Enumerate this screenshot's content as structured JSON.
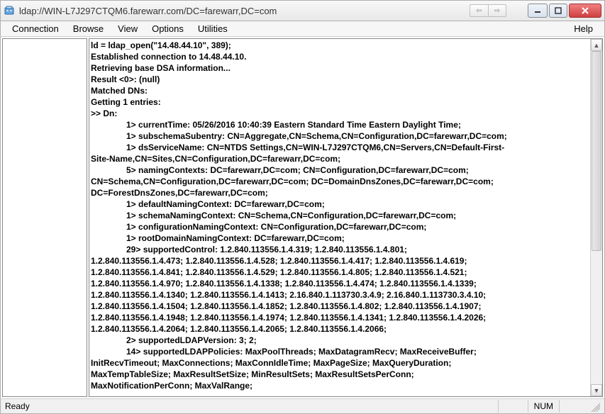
{
  "window": {
    "title": "ldap://WIN-L7J297CTQM6.farewarr.com/DC=farewarr,DC=com"
  },
  "menu": {
    "connection": "Connection",
    "browse": "Browse",
    "view": "View",
    "options": "Options",
    "utilities": "Utilities",
    "help": "Help"
  },
  "output": {
    "l0": "ld = ldap_open(\"14.48.44.10\", 389);",
    "l1": "Established connection to 14.48.44.10.",
    "l2": "Retrieving base DSA information...",
    "l3": "Result <0>: (null)",
    "l4": "Matched DNs: ",
    "l5": "Getting 1 entries:",
    "l6": ">> Dn: ",
    "l7": "1> currentTime: 05/26/2016 10:40:39 Eastern Standard Time Eastern Daylight Time; ",
    "l8": "1> subschemaSubentry: CN=Aggregate,CN=Schema,CN=Configuration,DC=farewarr,DC=com; ",
    "l9": "1> dsServiceName: CN=NTDS Settings,CN=WIN-L7J297CTQM6,CN=Servers,CN=Default-First-",
    "l10": "Site-Name,CN=Sites,CN=Configuration,DC=farewarr,DC=com; ",
    "l11": "5> namingContexts: DC=farewarr,DC=com; CN=Configuration,DC=farewarr,DC=com; ",
    "l12": "CN=Schema,CN=Configuration,DC=farewarr,DC=com; DC=DomainDnsZones,DC=farewarr,DC=com; ",
    "l13": "DC=ForestDnsZones,DC=farewarr,DC=com; ",
    "l14": "1> defaultNamingContext: DC=farewarr,DC=com; ",
    "l15": "1> schemaNamingContext: CN=Schema,CN=Configuration,DC=farewarr,DC=com; ",
    "l16": "1> configurationNamingContext: CN=Configuration,DC=farewarr,DC=com; ",
    "l17": "1> rootDomainNamingContext: DC=farewarr,DC=com; ",
    "l18": "29> supportedControl: 1.2.840.113556.1.4.319; 1.2.840.113556.1.4.801; ",
    "l19": "1.2.840.113556.1.4.473; 1.2.840.113556.1.4.528; 1.2.840.113556.1.4.417; 1.2.840.113556.1.4.619; ",
    "l20": "1.2.840.113556.1.4.841; 1.2.840.113556.1.4.529; 1.2.840.113556.1.4.805; 1.2.840.113556.1.4.521; ",
    "l21": "1.2.840.113556.1.4.970; 1.2.840.113556.1.4.1338; 1.2.840.113556.1.4.474; 1.2.840.113556.1.4.1339; ",
    "l22": "1.2.840.113556.1.4.1340; 1.2.840.113556.1.4.1413; 2.16.840.1.113730.3.4.9; 2.16.840.1.113730.3.4.10; ",
    "l23": "1.2.840.113556.1.4.1504; 1.2.840.113556.1.4.1852; 1.2.840.113556.1.4.802; 1.2.840.113556.1.4.1907; ",
    "l24": "1.2.840.113556.1.4.1948; 1.2.840.113556.1.4.1974; 1.2.840.113556.1.4.1341; 1.2.840.113556.1.4.2026; ",
    "l25": "1.2.840.113556.1.4.2064; 1.2.840.113556.1.4.2065; 1.2.840.113556.1.4.2066; ",
    "l26": "2> supportedLDAPVersion: 3; 2; ",
    "l27": "14> supportedLDAPPolicies: MaxPoolThreads; MaxDatagramRecv; MaxReceiveBuffer; ",
    "l28": "InitRecvTimeout; MaxConnections; MaxConnIdleTime; MaxPageSize; MaxQueryDuration; ",
    "l29": "MaxTempTableSize; MaxResultSetSize; MinResultSets; MaxResultSetsPerConn; ",
    "l30": "MaxNotificationPerConn; MaxValRange; "
  },
  "status": {
    "ready": "Ready",
    "num": "NUM"
  }
}
